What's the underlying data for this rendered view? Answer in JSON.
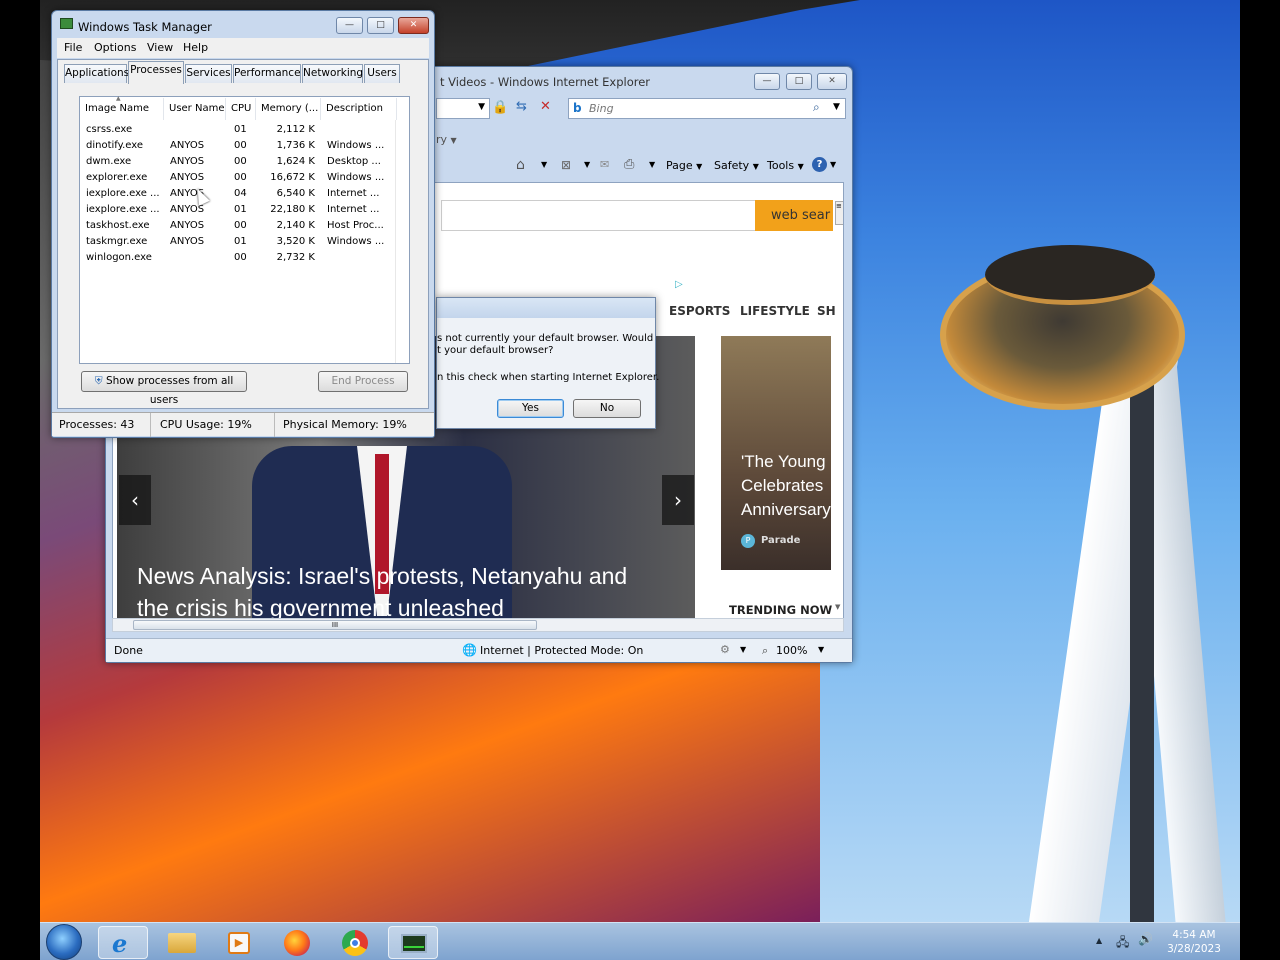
{
  "task_manager": {
    "title": "Windows Task Manager",
    "menu": [
      "File",
      "Options",
      "View",
      "Help"
    ],
    "tabs": [
      "Applications",
      "Processes",
      "Services",
      "Performance",
      "Networking",
      "Users"
    ],
    "active_tab": "Processes",
    "columns": [
      "Image Name",
      "User Name",
      "CPU",
      "Memory (...",
      "Description"
    ],
    "rows": [
      {
        "image": "csrss.exe",
        "user": "",
        "cpu": "01",
        "memory": "2,112 K",
        "desc": ""
      },
      {
        "image": "dinotify.exe",
        "user": "ANYOS",
        "cpu": "00",
        "memory": "1,736 K",
        "desc": "Windows ..."
      },
      {
        "image": "dwm.exe",
        "user": "ANYOS",
        "cpu": "00",
        "memory": "1,624 K",
        "desc": "Desktop ..."
      },
      {
        "image": "explorer.exe",
        "user": "ANYOS",
        "cpu": "00",
        "memory": "16,672 K",
        "desc": "Windows ..."
      },
      {
        "image": "iexplore.exe ...",
        "user": "ANYOS",
        "cpu": "04",
        "memory": "6,540 K",
        "desc": "Internet ..."
      },
      {
        "image": "iexplore.exe ...",
        "user": "ANYOS",
        "cpu": "01",
        "memory": "22,180 K",
        "desc": "Internet ..."
      },
      {
        "image": "taskhost.exe",
        "user": "ANYOS",
        "cpu": "00",
        "memory": "2,140 K",
        "desc": "Host Proc..."
      },
      {
        "image": "taskmgr.exe",
        "user": "ANYOS",
        "cpu": "01",
        "memory": "3,520 K",
        "desc": "Windows ..."
      },
      {
        "image": "winlogon.exe",
        "user": "",
        "cpu": "00",
        "memory": "2,732 K",
        "desc": ""
      }
    ],
    "show_all_button": "Show processes from all users",
    "end_process_button": "End Process",
    "status": {
      "processes": "Processes: 43",
      "cpu": "CPU Usage: 19%",
      "memory": "Physical Memory: 19%"
    }
  },
  "ie": {
    "title": "t Videos - Windows Internet Explorer",
    "search_placeholder": "Bing",
    "favorites_fragment": "ry",
    "toolbar": {
      "page": "Page",
      "safety": "Safety",
      "tools": "Tools"
    },
    "web_search_button": "web sear",
    "nav_links": [
      "ESPORTS",
      "LIFESTYLE",
      "SH"
    ],
    "headline": "News Analysis: Israel's protests, Netanyahu and the crisis his government unleashed",
    "side_story": "'The Young Celebrates Anniversary",
    "side_source": "Parade",
    "trending": "TRENDING NOW",
    "status_done": "Done",
    "status_zone": "Internet | Protected Mode: On",
    "zoom": "100%"
  },
  "dialog": {
    "line1": "s not currently your default browser. Would",
    "line2": "t your default browser?",
    "line3": "n this check when starting Internet Explorer.",
    "yes": "Yes",
    "no": "No"
  },
  "taskbar": {
    "time": "4:54 AM",
    "date": "3/28/2023",
    "icons": [
      "start-orb-icon",
      "internet-explorer-icon",
      "windows-explorer-icon",
      "media-player-icon",
      "firefox-icon",
      "chrome-icon",
      "task-manager-icon"
    ]
  }
}
